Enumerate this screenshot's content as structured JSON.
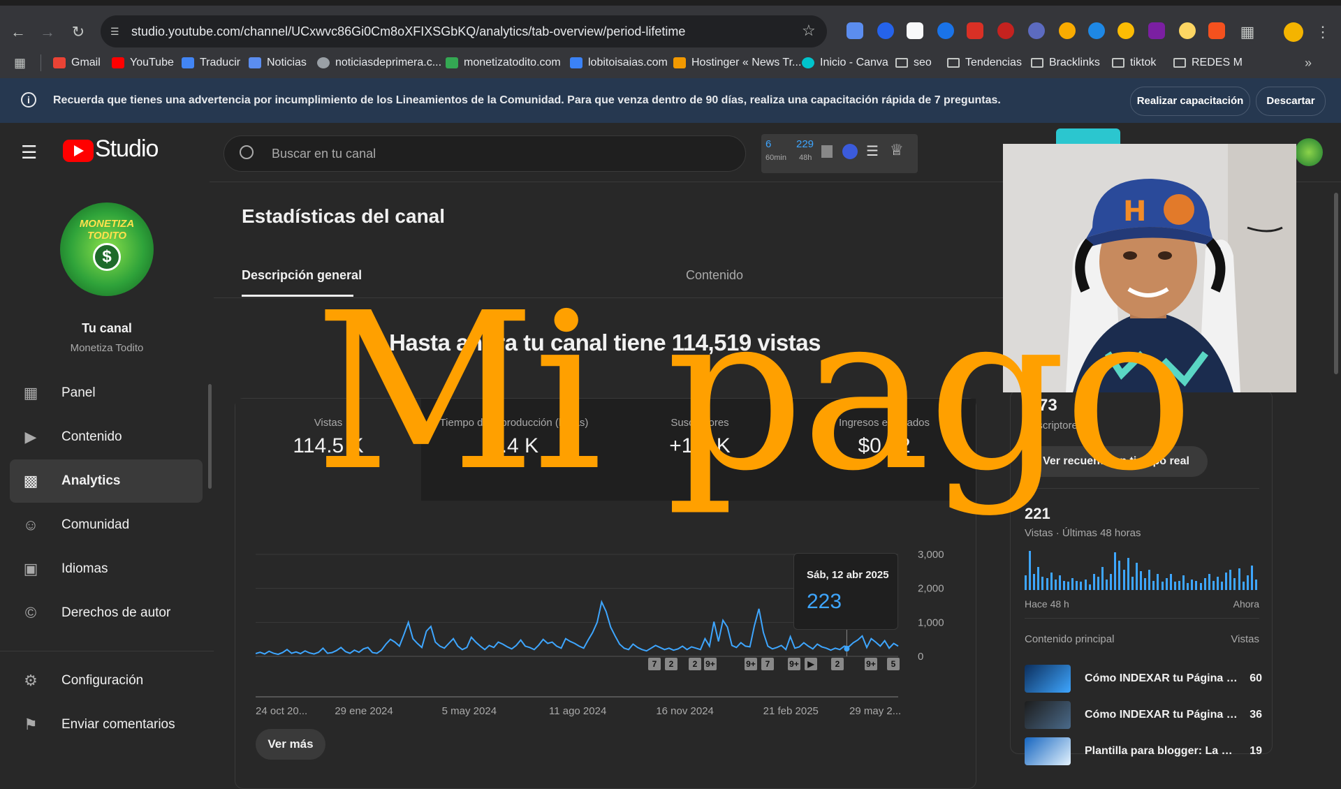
{
  "browser": {
    "url": "studio.youtube.com/channel/UCxwvc86Gi0Cm8oXFIXSGbKQ/analytics/tab-overview/period-lifetime",
    "bookmarks": [
      {
        "label": "Gmail",
        "color": "#ea4335"
      },
      {
        "label": "YouTube",
        "color": "#ff0000"
      },
      {
        "label": "Traducir",
        "color": "#4285f4"
      },
      {
        "label": "Noticias",
        "color": "#5b8def"
      },
      {
        "label": "noticiasdeprimera.c...",
        "color": "#9aa0a6"
      },
      {
        "label": "monetizatodito.com",
        "color": "#34a853"
      },
      {
        "label": "lobitoisaias.com",
        "color": "#3b82f6"
      },
      {
        "label": "Hostinger « News Tr...",
        "color": "#f29900"
      },
      {
        "label": "Inicio - Canva",
        "color": "#00c4cc"
      }
    ],
    "folders": [
      "seo",
      "Tendencias",
      "Bracklinks",
      "tiktok",
      "REDES M"
    ]
  },
  "banner": {
    "message": "Recuerda que tienes una advertencia por incumplimiento de los Lineamientos de la Comunidad. Para que venza dentro de 90 días, realiza una capacitación rápida de 7 preguntas.",
    "train_label": "Realizar capacitación",
    "dismiss_label": "Descartar"
  },
  "studio": {
    "logo_text": "Studio",
    "search_placeholder": "Buscar en tu canal",
    "ext": {
      "a_top": "6",
      "a_bottom": "60min",
      "b_top": "229",
      "b_bottom": "48h"
    }
  },
  "sidebar": {
    "channel_title": "Tu canal",
    "channel_name": "Monetiza Todito",
    "avatar_text": "MONETIZA TODITO",
    "items": [
      {
        "label": "Panel",
        "icon": "dashboard-icon"
      },
      {
        "label": "Contenido",
        "icon": "content-icon"
      },
      {
        "label": "Analytics",
        "icon": "analytics-icon",
        "active": true
      },
      {
        "label": "Comunidad",
        "icon": "community-icon"
      },
      {
        "label": "Idiomas",
        "icon": "languages-icon"
      },
      {
        "label": "Derechos de autor",
        "icon": "copyright-icon"
      }
    ],
    "bottom_items": [
      {
        "label": "Configuración",
        "icon": "gear-icon"
      },
      {
        "label": "Enviar comentarios",
        "icon": "feedback-icon"
      }
    ]
  },
  "main": {
    "page_title": "Estadísticas del canal",
    "tabs": [
      "Descripción general",
      "Contenido"
    ],
    "headline": "Hasta ahora tu canal tiene 114,519 vistas",
    "metrics": [
      {
        "label": "Vistas",
        "value": "114.5 K"
      },
      {
        "label": "Tiempo de reproducción (horas)",
        "value": "4.4 K"
      },
      {
        "label": "Suscriptores",
        "value": "+1.7 K"
      },
      {
        "label": "Ingresos estimados",
        "value": "$0.92"
      }
    ],
    "tooltip": {
      "date": "Sáb, 12 abr 2025",
      "value": "223"
    },
    "markers": [
      "7",
      "2",
      "2",
      "9+",
      "9+",
      "7",
      "9+",
      "▶",
      "2",
      "9+",
      "5"
    ],
    "see_more": "Ver más"
  },
  "chart_data": {
    "type": "line",
    "x_ticks": [
      "24 oct 20...",
      "29 ene 2024",
      "5 may 2024",
      "11 ago 2024",
      "16 nov 2024",
      "21 feb 2025",
      "29 may 2..."
    ],
    "y_ticks": [
      "0",
      "1,000",
      "2,000",
      "3,000"
    ],
    "ylim": [
      0,
      3000
    ],
    "grid": true,
    "series": [
      {
        "values": [
          80,
          120,
          70,
          150,
          90,
          60,
          110,
          200,
          90,
          130,
          80,
          160,
          100,
          70,
          120,
          240,
          90,
          110,
          170,
          260,
          140,
          90,
          180,
          120,
          220,
          260,
          110,
          90,
          180,
          360,
          500,
          420,
          300,
          640,
          1000,
          520,
          380,
          260,
          740,
          880,
          420,
          300,
          240,
          380,
          520,
          300,
          200,
          260,
          560,
          420,
          300,
          200,
          320,
          260,
          420,
          360,
          280,
          220,
          320,
          480,
          300,
          260,
          200,
          330,
          500,
          380,
          420,
          300,
          240,
          520,
          440,
          380,
          300,
          240,
          480,
          700,
          1000,
          1600,
          1320,
          860,
          600,
          360,
          240,
          200,
          360,
          260,
          200,
          160,
          240,
          320,
          260,
          200,
          240,
          180,
          220,
          300,
          200,
          280,
          240,
          200,
          520,
          300,
          1020,
          440,
          1060,
          860,
          320,
          260,
          400,
          300,
          280,
          900,
          1400,
          700,
          300,
          220,
          260,
          320,
          200,
          580,
          240,
          280,
          400,
          300,
          220,
          360,
          280,
          240,
          180,
          240,
          200,
          300,
          280,
          400,
          480,
          600,
          260,
          520,
          420,
          300,
          460,
          240,
          380,
          300
        ]
      }
    ]
  },
  "realtime": {
    "subs_value": "1,73",
    "subs_label": "Suscriptores",
    "realtime_button": "Ver recuento en tiempo real",
    "views_48h": "221",
    "views_48h_label": "Vistas · Últimas 48 horas",
    "bars": [
      22,
      58,
      24,
      34,
      20,
      18,
      26,
      16,
      22,
      14,
      12,
      18,
      14,
      12,
      16,
      8,
      24,
      20,
      34,
      16,
      24,
      56,
      44,
      30,
      48,
      20,
      40,
      28,
      18,
      30,
      14,
      24,
      12,
      18,
      24,
      12,
      14,
      22,
      10,
      16,
      14,
      10,
      18,
      24,
      14,
      20,
      12,
      26,
      30,
      18,
      32,
      12,
      22,
      36,
      16
    ],
    "left_label": "Hace 48 h",
    "right_label": "Ahora",
    "top_content_label": "Contenido principal",
    "views_col": "Vistas",
    "top_content": [
      {
        "title": "Cómo INDEXAR tu Página W...",
        "views": "60"
      },
      {
        "title": "Cómo INDEXAR tu Página W...",
        "views": "36"
      },
      {
        "title": "Plantilla para blogger: La ma...",
        "views": "19"
      }
    ]
  },
  "overlay": {
    "text": "Mi pago"
  }
}
